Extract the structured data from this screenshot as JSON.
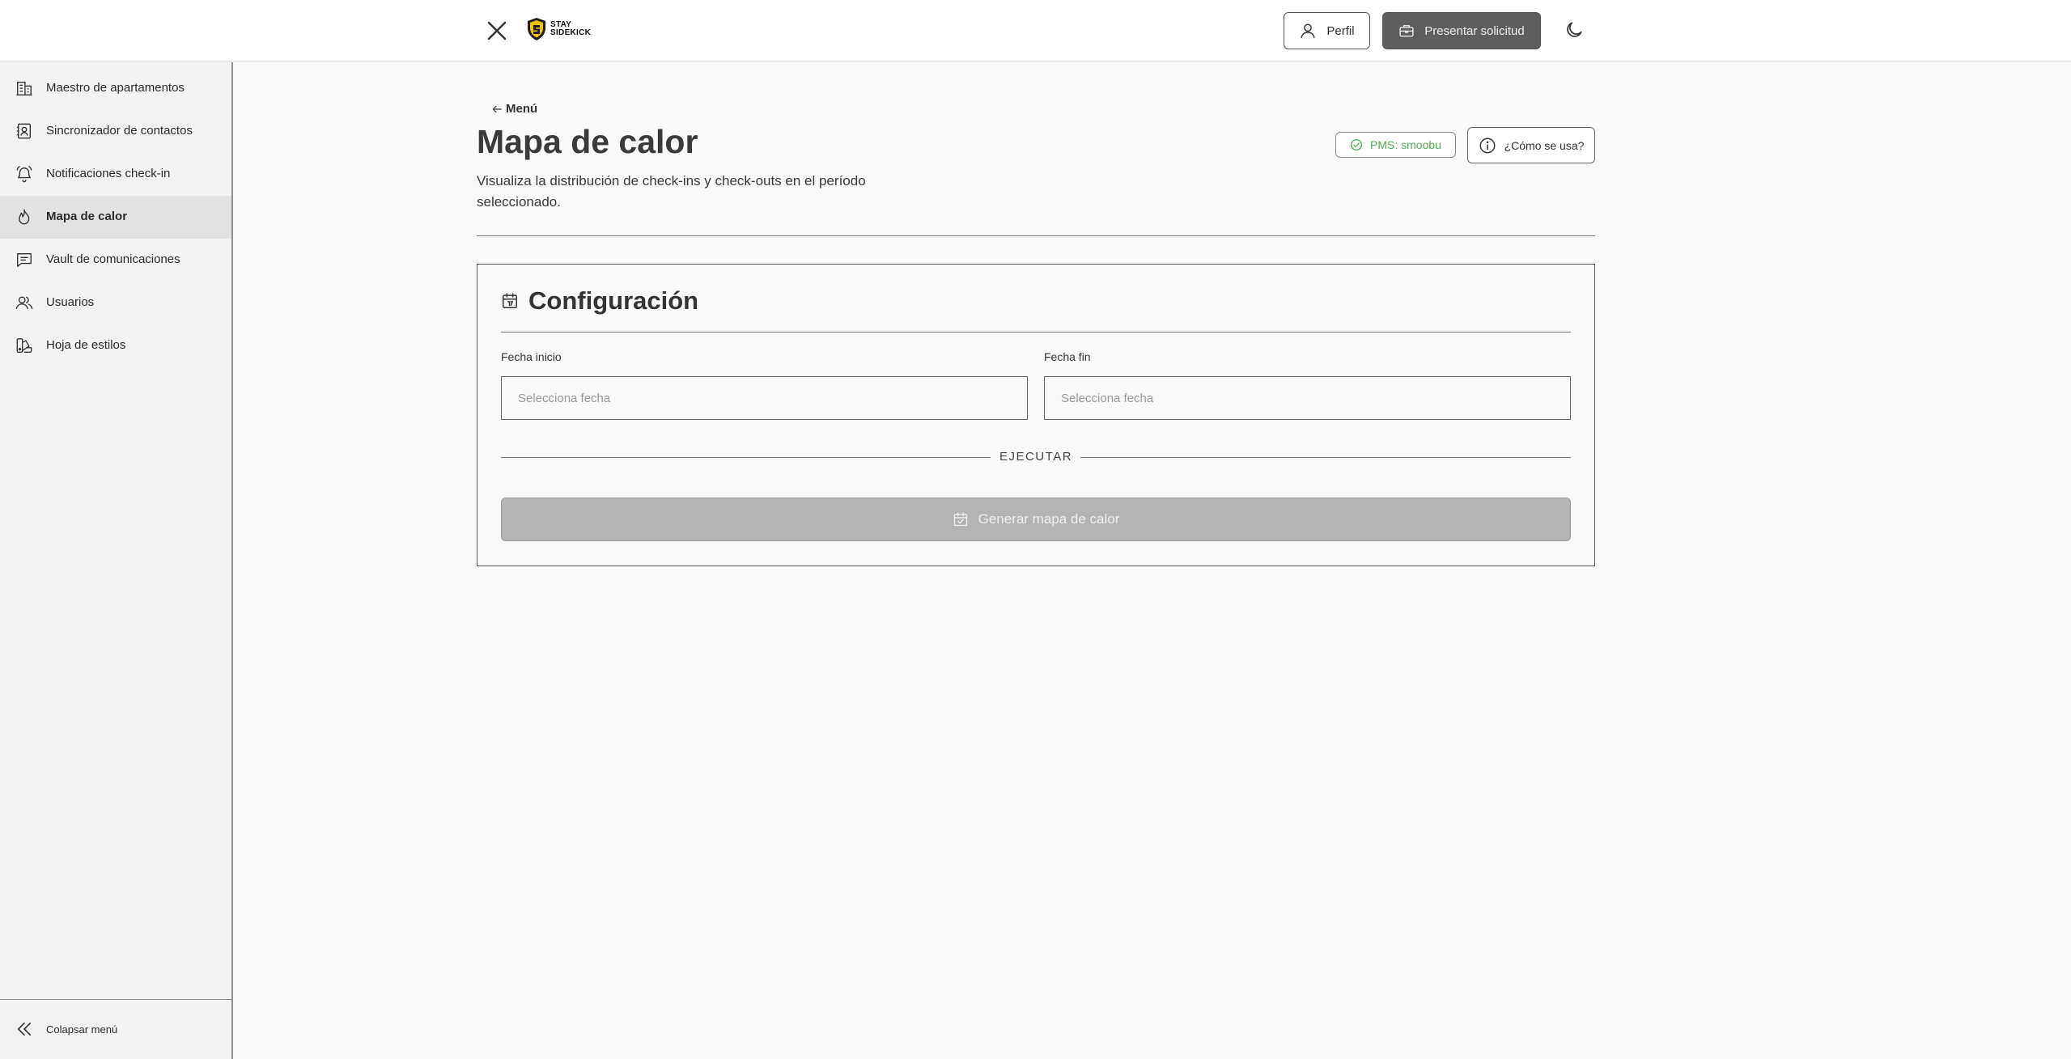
{
  "header": {
    "logo_line1": "STAY",
    "logo_line2": "SIDEKICK",
    "profile_label": "Perfil",
    "submit_label": "Presentar solicitud"
  },
  "sidebar": {
    "items": [
      {
        "label": "Maestro de apartamentos",
        "icon": "building-icon"
      },
      {
        "label": "Sincronizador de contactos",
        "icon": "contact-book-icon"
      },
      {
        "label": "Notificaciones check-in",
        "icon": "bell-icon"
      },
      {
        "label": "Mapa de calor",
        "icon": "flame-icon",
        "active": true
      },
      {
        "label": "Vault de comunicaciones",
        "icon": "message-square-icon"
      },
      {
        "label": "Usuarios",
        "icon": "users-icon"
      },
      {
        "label": "Hoja de estilos",
        "icon": "swatch-book-icon"
      }
    ],
    "collapse_label": "Colapsar menú"
  },
  "main": {
    "back_label": "Menú",
    "title": "Mapa de calor",
    "description": "Visualiza la distribución de check-ins y check-outs en el período seleccionado.",
    "pms_badge": "PMS: smoobu",
    "help_label": "¿Cómo se usa?"
  },
  "config": {
    "title": "Configuración",
    "start_label": "Fecha inicio",
    "start_placeholder": "Selecciona fecha",
    "end_label": "Fecha fin",
    "end_placeholder": "Selecciona fecha",
    "separator_label": "EJECUTAR",
    "generate_label": "Generar mapa de calor"
  },
  "colors": {
    "accent_green": "#4caf50",
    "primary_button": "#5e5e5e",
    "disabled_button": "#b4b4b4",
    "active_nav": "#e2e2e2"
  }
}
